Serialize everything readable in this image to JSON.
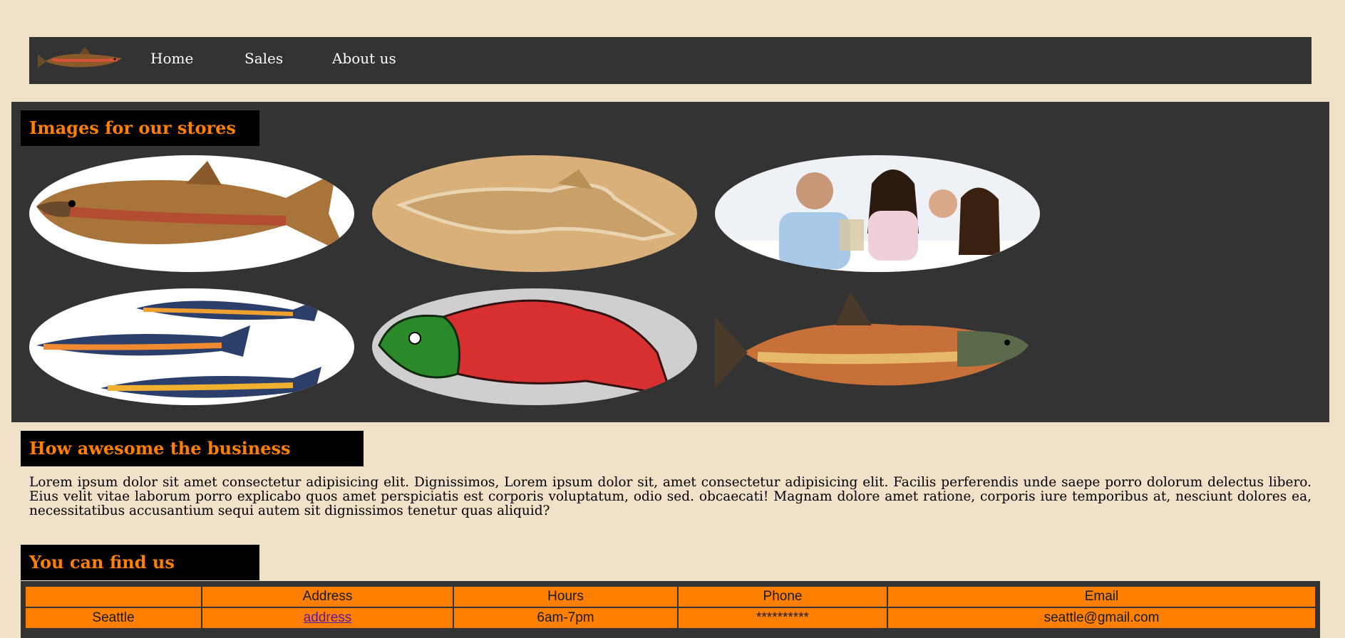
{
  "nav": {
    "logo_icon": "salmon-logo-icon",
    "links": [
      "Home",
      "Sales",
      "About us"
    ]
  },
  "sections": {
    "images_title": "Images for our stores",
    "business_title": "How awesome the business",
    "find_title": "You can find us"
  },
  "gallery": {
    "images": [
      "trout-illustration-icon",
      "fish-cookie-cutter-icon",
      "family-photo-icon",
      "colorful-fish-illustration-icon",
      "salmon-cookie-icon",
      "sockeye-salmon-illustration-icon"
    ]
  },
  "business_text": "Lorem ipsum dolor sit amet consectetur adipisicing elit. Dignissimos, Lorem ipsum dolor sit, amet consectetur adipisicing elit. Facilis perferendis unde saepe porro dolorum delectus libero. Eius velit vitae laborum porro explicabo quos amet perspiciatis est corporis voluptatum, odio sed. obcaecati! Magnam dolore amet ratione, corporis iure temporibus at, nesciunt dolores ea, necessitatibus accusantium sequi autem sit dignissimos tenetur quas aliquid?",
  "table": {
    "headers": [
      "",
      "Address",
      "Hours",
      "Phone",
      "Email"
    ],
    "rows": [
      {
        "city": "Seattle",
        "address": "address",
        "hours": "6am-7pm",
        "phone": "**********",
        "email": "seattle@gmail.com"
      }
    ]
  },
  "colors": {
    "page_bg": "#f0e1c8",
    "panel_bg": "#333333",
    "heading_bg": "#000000",
    "accent": "#ff8000"
  }
}
